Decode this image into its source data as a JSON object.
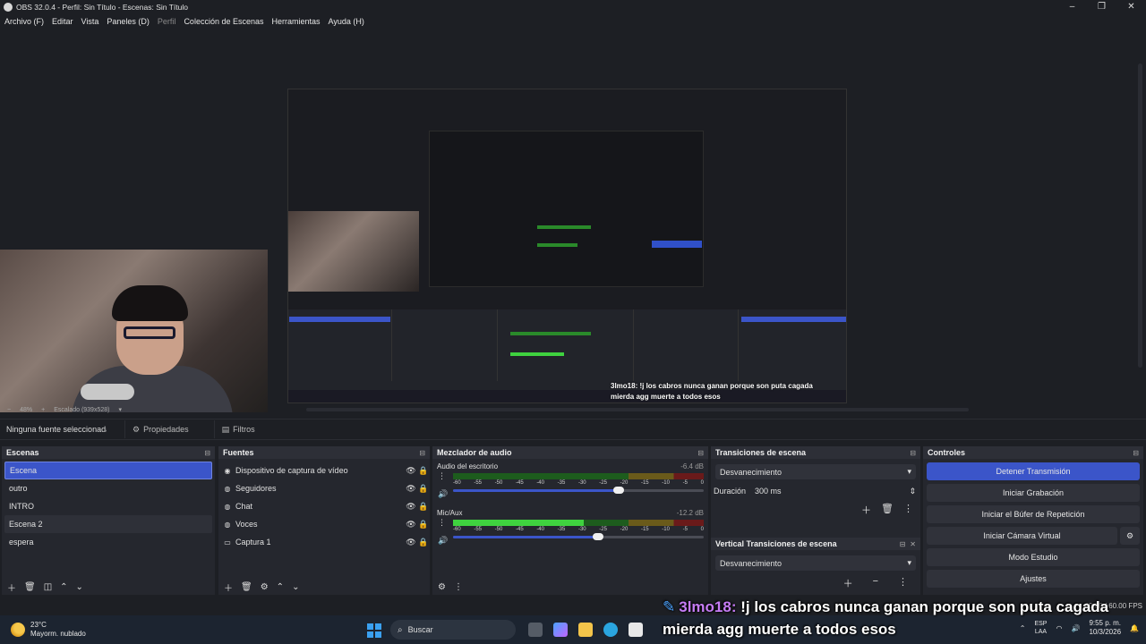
{
  "window": {
    "title": "OBS 32.0.4 - Perfil: Sin Título - Escenas: Sin Título",
    "controls": [
      "–",
      "❐",
      "✕"
    ]
  },
  "menu": {
    "archivo": "Archivo (F)",
    "editar": "Editar",
    "vista": "Vista",
    "paneles": "Paneles (D)",
    "perfil": "Perfil",
    "coleccion": "Colección de Escenas",
    "herramientas": "Herramientas",
    "ayuda": "Ayuda (H)"
  },
  "preview": {
    "zoom": "48%",
    "scaling": "Escalado (939x528)",
    "nested_chat_line1": "3lmo18: !j los cabros nunca ganan porque son puta cagada",
    "nested_chat_line2": "mierda agg muerte a todos esos"
  },
  "source_bar": {
    "no_selection": "Ninguna fuente seleccionada",
    "properties": "Propiedades",
    "filters": "Filtros"
  },
  "scenes": {
    "title": "Escenas",
    "items": [
      "Escena",
      "outro",
      "INTRO",
      "Escena 2",
      "espera"
    ],
    "selected": "Escena"
  },
  "sources": {
    "title": "Fuentes",
    "items": [
      {
        "label": "Dispositivo de captura de vídeo",
        "icon": "camera-icon"
      },
      {
        "label": "Seguidores",
        "icon": "globe-icon"
      },
      {
        "label": "Chat",
        "icon": "globe-icon"
      },
      {
        "label": "Voces",
        "icon": "globe-icon"
      },
      {
        "label": "Captura 1",
        "icon": "monitor-icon"
      }
    ]
  },
  "mixer": {
    "title": "Mezclador de audio",
    "channels": [
      {
        "name": "Audio del escritorio",
        "db": "-6.4 dB",
        "level": 0.0,
        "volume": 0.66
      },
      {
        "name": "Mic/Aux",
        "db": "-12.2 dB",
        "level": 0.52,
        "volume": 0.58
      }
    ],
    "ticks": [
      "-60",
      "-55",
      "-50",
      "-45",
      "-40",
      "-35",
      "-30",
      "-25",
      "-20",
      "-15",
      "-10",
      "-5",
      "0"
    ]
  },
  "transitions": {
    "title": "Transiciones de escena",
    "selected": "Desvanecimiento",
    "duration_label": "Duración",
    "duration_value": "300 ms"
  },
  "vtransitions": {
    "title": "Vertical Transiciones de escena",
    "selected": "Desvanecimiento"
  },
  "controls": {
    "title": "Controles",
    "stop_stream": "Detener Transmisión",
    "start_recording": "Iniciar Grabación",
    "start_replay": "Iniciar el Búfer de Repetición",
    "start_vcam": "Iniciar Cámara Virtual",
    "studio_mode": "Modo Estudio",
    "settings": "Ajustes"
  },
  "status": {
    "fps": "60.00 / 60.00 FPS"
  },
  "chat_overlay": {
    "user": "3lmo18:",
    "line1": " !j los cabros nunca ganan porque son puta cagada",
    "line2": "mierda agg muerte a todos esos"
  },
  "taskbar": {
    "temp": "23°C",
    "weather": "Mayorm. nublado",
    "search": "Buscar",
    "lang1": "ESP",
    "lang2": "LAA",
    "time": "9:55 p. m.",
    "date": "10/3/2026"
  },
  "colors": {
    "accent": "#3b55c9",
    "panel": "#25272e",
    "background": "#1d1f24",
    "chat_user": "#c67cf5"
  }
}
